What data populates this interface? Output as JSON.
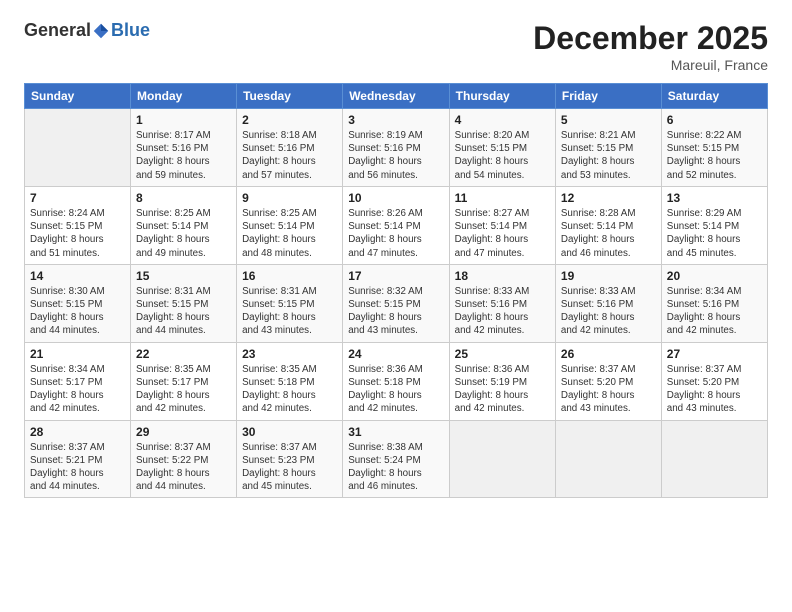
{
  "logo": {
    "general": "General",
    "blue": "Blue"
  },
  "title": "December 2025",
  "location": "Mareuil, France",
  "days_of_week": [
    "Sunday",
    "Monday",
    "Tuesday",
    "Wednesday",
    "Thursday",
    "Friday",
    "Saturday"
  ],
  "weeks": [
    [
      {
        "day": "",
        "info": ""
      },
      {
        "day": "1",
        "info": "Sunrise: 8:17 AM\nSunset: 5:16 PM\nDaylight: 8 hours\nand 59 minutes."
      },
      {
        "day": "2",
        "info": "Sunrise: 8:18 AM\nSunset: 5:16 PM\nDaylight: 8 hours\nand 57 minutes."
      },
      {
        "day": "3",
        "info": "Sunrise: 8:19 AM\nSunset: 5:16 PM\nDaylight: 8 hours\nand 56 minutes."
      },
      {
        "day": "4",
        "info": "Sunrise: 8:20 AM\nSunset: 5:15 PM\nDaylight: 8 hours\nand 54 minutes."
      },
      {
        "day": "5",
        "info": "Sunrise: 8:21 AM\nSunset: 5:15 PM\nDaylight: 8 hours\nand 53 minutes."
      },
      {
        "day": "6",
        "info": "Sunrise: 8:22 AM\nSunset: 5:15 PM\nDaylight: 8 hours\nand 52 minutes."
      }
    ],
    [
      {
        "day": "7",
        "info": "Sunrise: 8:24 AM\nSunset: 5:15 PM\nDaylight: 8 hours\nand 51 minutes."
      },
      {
        "day": "8",
        "info": "Sunrise: 8:25 AM\nSunset: 5:14 PM\nDaylight: 8 hours\nand 49 minutes."
      },
      {
        "day": "9",
        "info": "Sunrise: 8:25 AM\nSunset: 5:14 PM\nDaylight: 8 hours\nand 48 minutes."
      },
      {
        "day": "10",
        "info": "Sunrise: 8:26 AM\nSunset: 5:14 PM\nDaylight: 8 hours\nand 47 minutes."
      },
      {
        "day": "11",
        "info": "Sunrise: 8:27 AM\nSunset: 5:14 PM\nDaylight: 8 hours\nand 47 minutes."
      },
      {
        "day": "12",
        "info": "Sunrise: 8:28 AM\nSunset: 5:14 PM\nDaylight: 8 hours\nand 46 minutes."
      },
      {
        "day": "13",
        "info": "Sunrise: 8:29 AM\nSunset: 5:14 PM\nDaylight: 8 hours\nand 45 minutes."
      }
    ],
    [
      {
        "day": "14",
        "info": "Sunrise: 8:30 AM\nSunset: 5:15 PM\nDaylight: 8 hours\nand 44 minutes."
      },
      {
        "day": "15",
        "info": "Sunrise: 8:31 AM\nSunset: 5:15 PM\nDaylight: 8 hours\nand 44 minutes."
      },
      {
        "day": "16",
        "info": "Sunrise: 8:31 AM\nSunset: 5:15 PM\nDaylight: 8 hours\nand 43 minutes."
      },
      {
        "day": "17",
        "info": "Sunrise: 8:32 AM\nSunset: 5:15 PM\nDaylight: 8 hours\nand 43 minutes."
      },
      {
        "day": "18",
        "info": "Sunrise: 8:33 AM\nSunset: 5:16 PM\nDaylight: 8 hours\nand 42 minutes."
      },
      {
        "day": "19",
        "info": "Sunrise: 8:33 AM\nSunset: 5:16 PM\nDaylight: 8 hours\nand 42 minutes."
      },
      {
        "day": "20",
        "info": "Sunrise: 8:34 AM\nSunset: 5:16 PM\nDaylight: 8 hours\nand 42 minutes."
      }
    ],
    [
      {
        "day": "21",
        "info": "Sunrise: 8:34 AM\nSunset: 5:17 PM\nDaylight: 8 hours\nand 42 minutes."
      },
      {
        "day": "22",
        "info": "Sunrise: 8:35 AM\nSunset: 5:17 PM\nDaylight: 8 hours\nand 42 minutes."
      },
      {
        "day": "23",
        "info": "Sunrise: 8:35 AM\nSunset: 5:18 PM\nDaylight: 8 hours\nand 42 minutes."
      },
      {
        "day": "24",
        "info": "Sunrise: 8:36 AM\nSunset: 5:18 PM\nDaylight: 8 hours\nand 42 minutes."
      },
      {
        "day": "25",
        "info": "Sunrise: 8:36 AM\nSunset: 5:19 PM\nDaylight: 8 hours\nand 42 minutes."
      },
      {
        "day": "26",
        "info": "Sunrise: 8:37 AM\nSunset: 5:20 PM\nDaylight: 8 hours\nand 43 minutes."
      },
      {
        "day": "27",
        "info": "Sunrise: 8:37 AM\nSunset: 5:20 PM\nDaylight: 8 hours\nand 43 minutes."
      }
    ],
    [
      {
        "day": "28",
        "info": "Sunrise: 8:37 AM\nSunset: 5:21 PM\nDaylight: 8 hours\nand 44 minutes."
      },
      {
        "day": "29",
        "info": "Sunrise: 8:37 AM\nSunset: 5:22 PM\nDaylight: 8 hours\nand 44 minutes."
      },
      {
        "day": "30",
        "info": "Sunrise: 8:37 AM\nSunset: 5:23 PM\nDaylight: 8 hours\nand 45 minutes."
      },
      {
        "day": "31",
        "info": "Sunrise: 8:38 AM\nSunset: 5:24 PM\nDaylight: 8 hours\nand 46 minutes."
      },
      {
        "day": "",
        "info": ""
      },
      {
        "day": "",
        "info": ""
      },
      {
        "day": "",
        "info": ""
      }
    ]
  ]
}
